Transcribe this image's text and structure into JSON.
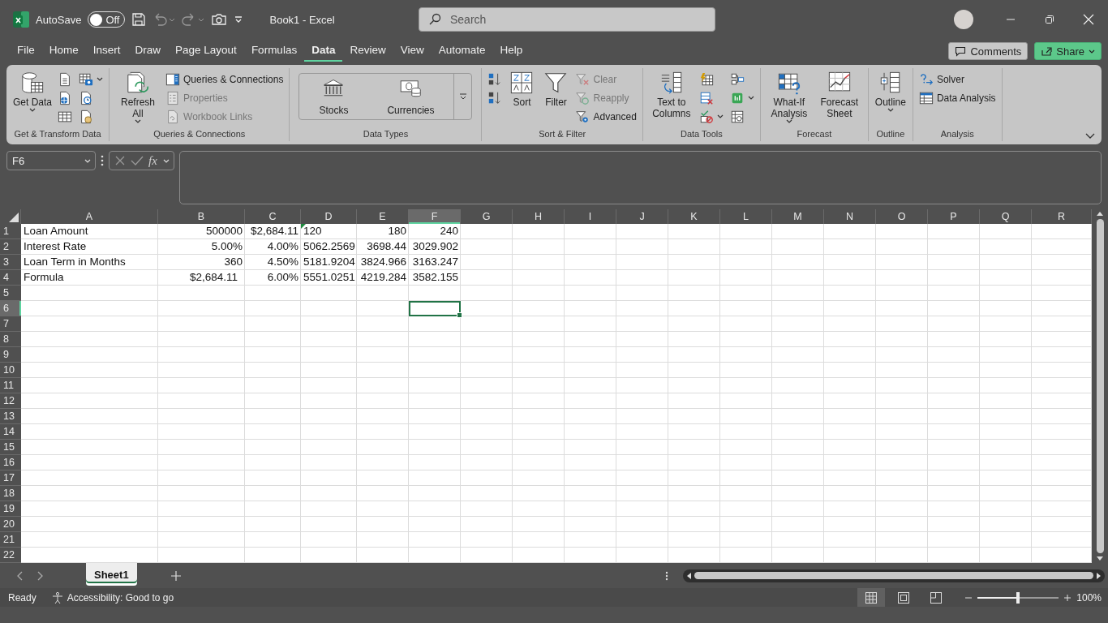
{
  "window": {
    "title": "Book1  -  Excel"
  },
  "quick_access": {
    "autosave_label": "AutoSave",
    "autosave_state": "Off",
    "autosave_on": false
  },
  "search": {
    "placeholder": "Search"
  },
  "tabs": [
    {
      "label": "File",
      "selected": false
    },
    {
      "label": "Home",
      "selected": false
    },
    {
      "label": "Insert",
      "selected": false
    },
    {
      "label": "Draw",
      "selected": false
    },
    {
      "label": "Page Layout",
      "selected": false
    },
    {
      "label": "Formulas",
      "selected": false
    },
    {
      "label": "Data",
      "selected": true
    },
    {
      "label": "Review",
      "selected": false
    },
    {
      "label": "View",
      "selected": false
    },
    {
      "label": "Automate",
      "selected": false
    },
    {
      "label": "Help",
      "selected": false
    }
  ],
  "header_buttons": [
    {
      "label": "Comments",
      "kind": "outline",
      "dropdown": false
    },
    {
      "label": "Share",
      "kind": "primary",
      "dropdown": true
    }
  ],
  "ribbon": {
    "groups": [
      {
        "label": "Get & Transform Data",
        "items": [
          {
            "kind": "large",
            "label": "Get Data",
            "dropdown": true
          },
          {
            "kind": "icon"
          },
          {
            "kind": "icon"
          },
          {
            "kind": "icon"
          },
          {
            "kind": "icon",
            "dropdown": true
          },
          {
            "kind": "icon"
          },
          {
            "kind": "icon"
          }
        ]
      },
      {
        "label": "Queries & Connections",
        "items": [
          {
            "kind": "large",
            "label": "Refresh All",
            "dropdown": true
          },
          {
            "kind": "small",
            "label": "Queries & Connections",
            "disabled": false
          },
          {
            "kind": "small",
            "label": "Properties",
            "disabled": true
          },
          {
            "kind": "small",
            "label": "Workbook Links",
            "disabled": true
          }
        ]
      },
      {
        "label": "Data Types",
        "items": [
          {
            "kind": "gallery",
            "label": "Stocks"
          },
          {
            "kind": "gallery",
            "label": "Currencies"
          },
          {
            "kind": "more"
          }
        ]
      },
      {
        "label": "Sort & Filter",
        "items": [
          {
            "kind": "icon"
          },
          {
            "kind": "icon"
          },
          {
            "kind": "large",
            "label": "Sort"
          },
          {
            "kind": "large",
            "label": "Filter"
          },
          {
            "kind": "small",
            "label": "Clear",
            "disabled": true
          },
          {
            "kind": "small",
            "label": "Reapply",
            "disabled": true
          },
          {
            "kind": "small",
            "label": "Advanced",
            "disabled": false
          }
        ]
      },
      {
        "label": "Data Tools",
        "items": [
          {
            "kind": "large",
            "label": "Text to Columns"
          },
          {
            "kind": "icon"
          },
          {
            "kind": "icon"
          },
          {
            "kind": "icon",
            "dropdown": true
          },
          {
            "kind": "icon"
          },
          {
            "kind": "icon",
            "dropdown": true
          },
          {
            "kind": "icon"
          }
        ]
      },
      {
        "label": "Forecast",
        "items": [
          {
            "kind": "large",
            "label": "What-If Analysis",
            "dropdown": true
          },
          {
            "kind": "large",
            "label": "Forecast Sheet"
          }
        ]
      },
      {
        "label": "Outline",
        "items": [
          {
            "kind": "large",
            "label": "Outline",
            "dropdown": true
          }
        ]
      },
      {
        "label": "Analysis",
        "items": [
          {
            "kind": "small",
            "label": "Solver",
            "disabled": false
          },
          {
            "kind": "small",
            "label": "Data Analysis",
            "disabled": false
          }
        ]
      }
    ]
  },
  "formula_bar": {
    "name_box": "F6",
    "function_label": "fx"
  },
  "sheet": {
    "columns": [
      {
        "label": "A",
        "selected": false
      },
      {
        "label": "B",
        "selected": false
      },
      {
        "label": "C",
        "selected": false
      },
      {
        "label": "D",
        "selected": false
      },
      {
        "label": "E",
        "selected": false
      },
      {
        "label": "F",
        "selected": true
      },
      {
        "label": "G",
        "selected": false
      },
      {
        "label": "H",
        "selected": false
      },
      {
        "label": "I",
        "selected": false
      },
      {
        "label": "J",
        "selected": false
      },
      {
        "label": "K",
        "selected": false
      },
      {
        "label": "L",
        "selected": false
      },
      {
        "label": "M",
        "selected": false
      },
      {
        "label": "N",
        "selected": false
      },
      {
        "label": "O",
        "selected": false
      },
      {
        "label": "P",
        "selected": false
      },
      {
        "label": "Q",
        "selected": false
      },
      {
        "label": "R",
        "selected": false
      }
    ],
    "rows": [
      {
        "label": "1",
        "selected": false,
        "cells": [
          {
            "text": "Loan Amount",
            "kind": "text"
          },
          {
            "text": "500000",
            "kind": "number"
          },
          {
            "text": "$2,684.11",
            "kind": "number"
          },
          {
            "text": "120",
            "kind": "text",
            "error_flag": true
          },
          {
            "text": "180",
            "kind": "number"
          },
          {
            "text": "240",
            "kind": "number"
          }
        ]
      },
      {
        "label": "2",
        "selected": false,
        "cells": [
          {
            "text": "Interest Rate",
            "kind": "text"
          },
          {
            "text": "5.00%",
            "kind": "number"
          },
          {
            "text": "4.00%",
            "kind": "number"
          },
          {
            "text": "5062.2569",
            "kind": "number"
          },
          {
            "text": "3698.44",
            "kind": "number"
          },
          {
            "text": "3029.902",
            "kind": "number"
          }
        ]
      },
      {
        "label": "3",
        "selected": false,
        "cells": [
          {
            "text": "Loan Term in Months",
            "kind": "text"
          },
          {
            "text": "360",
            "kind": "number"
          },
          {
            "text": "4.50%",
            "kind": "number"
          },
          {
            "text": "5181.9204",
            "kind": "number"
          },
          {
            "text": "3824.966",
            "kind": "number"
          },
          {
            "text": "3163.247",
            "kind": "number"
          }
        ]
      },
      {
        "label": "4",
        "selected": false,
        "cells": [
          {
            "text": "Formula",
            "kind": "text"
          },
          {
            "text": "$2,684.11",
            "kind": "currency"
          },
          {
            "text": "6.00%",
            "kind": "number"
          },
          {
            "text": "5551.0251",
            "kind": "number"
          },
          {
            "text": "4219.284",
            "kind": "number"
          },
          {
            "text": "3582.155",
            "kind": "number"
          }
        ]
      },
      {
        "label": "5",
        "selected": false
      },
      {
        "label": "6",
        "selected": true
      },
      {
        "label": "7",
        "selected": false
      },
      {
        "label": "8",
        "selected": false
      },
      {
        "label": "9",
        "selected": false
      },
      {
        "label": "10",
        "selected": false
      },
      {
        "label": "11",
        "selected": false
      },
      {
        "label": "12",
        "selected": false
      },
      {
        "label": "13",
        "selected": false
      },
      {
        "label": "14",
        "selected": false
      },
      {
        "label": "15",
        "selected": false
      },
      {
        "label": "16",
        "selected": false
      },
      {
        "label": "17",
        "selected": false
      },
      {
        "label": "18",
        "selected": false
      },
      {
        "label": "19",
        "selected": false
      },
      {
        "label": "20",
        "selected": false
      },
      {
        "label": "21",
        "selected": false
      },
      {
        "label": "22",
        "selected": false
      }
    ]
  },
  "sheet_tabs": [
    {
      "label": "Sheet1",
      "selected": true
    }
  ],
  "status_bar": {
    "mode": "Ready",
    "accessibility": "Accessibility: Good to go",
    "views": [
      {
        "selected": true
      },
      {
        "selected": false
      },
      {
        "selected": false
      }
    ],
    "zoom": {
      "level": 0.5,
      "label": "100%"
    }
  }
}
